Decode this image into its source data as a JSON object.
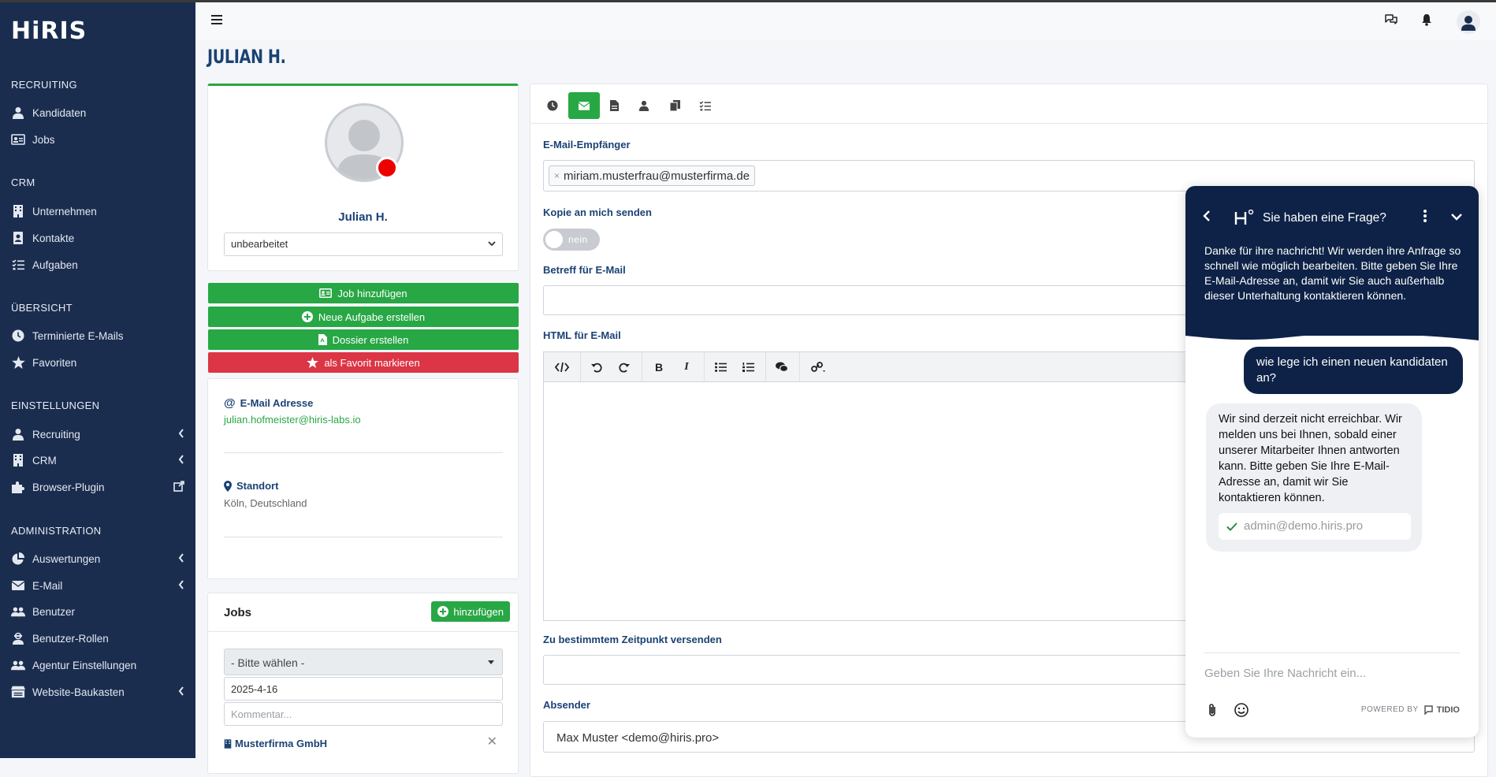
{
  "app": {
    "logo": "HiRIS"
  },
  "sidebar": {
    "sections": [
      {
        "title": "RECRUITING",
        "items": [
          {
            "label": "Kandidaten",
            "icon": "user-tie-icon"
          },
          {
            "label": "Jobs",
            "icon": "id-card-icon"
          }
        ]
      },
      {
        "title": "CRM",
        "items": [
          {
            "label": "Unternehmen",
            "icon": "building-icon"
          },
          {
            "label": "Kontakte",
            "icon": "address-book-icon"
          },
          {
            "label": "Aufgaben",
            "icon": "task-list-icon"
          }
        ]
      },
      {
        "title": "ÜBERSICHT",
        "items": [
          {
            "label": "Terminierte E-Mails",
            "icon": "clock-icon"
          },
          {
            "label": "Favoriten",
            "icon": "star-icon"
          }
        ]
      },
      {
        "title": "EINSTELLUNGEN",
        "items": [
          {
            "label": "Recruiting",
            "icon": "user-tie-icon"
          },
          {
            "label": "CRM",
            "icon": "building-icon"
          },
          {
            "label": "Browser-Plugin",
            "icon": "puzzle-icon"
          }
        ]
      },
      {
        "title": "ADMINISTRATION",
        "items": [
          {
            "label": "Auswertungen",
            "icon": "pie-chart-icon"
          },
          {
            "label": "E-Mail",
            "icon": "envelope-icon"
          },
          {
            "label": "Benutzer",
            "icon": "users-icon"
          },
          {
            "label": "Benutzer-Rollen",
            "icon": "user-secret-icon"
          },
          {
            "label": "Agentur Einstellungen",
            "icon": "users-cog-icon"
          },
          {
            "label": "Website-Baukasten",
            "icon": "store-icon"
          }
        ]
      }
    ]
  },
  "page": {
    "title": "JULIAN H."
  },
  "profile": {
    "name": "Julian H.",
    "status": "unbearbeitet",
    "buttons": {
      "add_job": "Job hinzufügen",
      "new_task": "Neue Aufgabe erstellen",
      "dossier": "Dossier erstellen",
      "favorite": "als Favorit markieren"
    },
    "email_label": "E-Mail Adresse",
    "email": "julian.hofmeister@hiris-labs.io",
    "location_label": "Standort",
    "location": "Köln, Deutschland"
  },
  "jobs": {
    "title": "Jobs",
    "add_label": "hinzufügen",
    "select_placeholder": "- Bitte wählen -",
    "date": "2025-4-16",
    "comment_placeholder": "Kommentar...",
    "company": "Musterfirma GmbH"
  },
  "email_form": {
    "tabs": [
      "clock-icon",
      "envelope-icon",
      "file-icon",
      "user-icon",
      "copy-icon",
      "tasks-icon"
    ],
    "recipient_label": "E-Mail-Empfänger",
    "recipient": "miriam.musterfrau@musterfirma.de",
    "copy_label": "Kopie an mich senden",
    "copy_toggle": "nein",
    "subject_label": "Betreff für E-Mail",
    "html_label": "HTML für E-Mail",
    "schedule_label": "Zu bestimmtem Zeitpunkt versenden",
    "sender_label": "Absender",
    "sender": "Max Muster <demo@hiris.pro>"
  },
  "chat": {
    "title": "Sie haben eine Frage?",
    "intro": "Danke für ihre nachricht! Wir werden ihre Anfrage so schnell wie möglich bearbeiten. Bitte geben Sie Ihre E-Mail-Adresse an, damit wir Sie auch außerhalb dieser Unterhaltung kontaktieren können.",
    "user_message": "wie lege ich einen neuen kandidaten an?",
    "bot_message": "Wir sind derzeit nicht erreichbar. Wir melden uns bei Ihnen, sobald einer unserer Mitarbeiter Ihnen antworten kann. Bitte geben Sie Ihre E-Mail-Adresse an, damit wir Sie kontaktieren können.",
    "email_confirmed": "admin@demo.hiris.pro",
    "input_placeholder": "Geben Sie Ihre Nachricht ein...",
    "powered_by": "POWERED BY",
    "brand": "TIDIO"
  },
  "colors": {
    "sidebar": "#1b2d4f",
    "accent_green": "#28a745",
    "danger_red": "#dc3545",
    "title_blue": "#1b4274",
    "chat_navy": "#0d2246"
  }
}
